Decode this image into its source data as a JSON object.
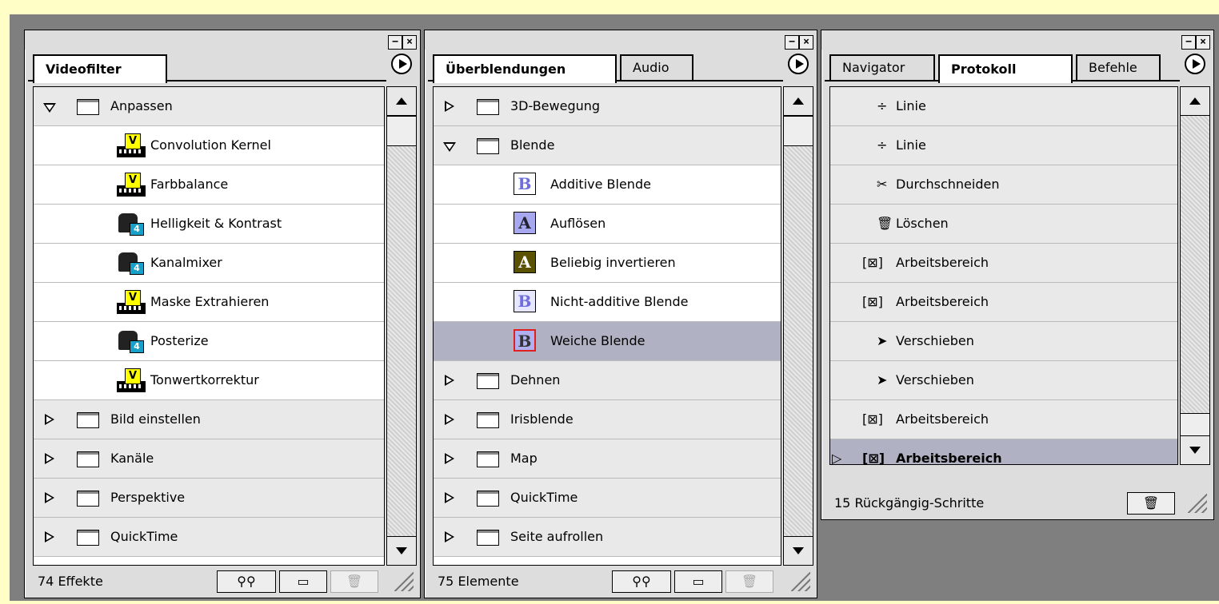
{
  "panels": {
    "left": {
      "tabs": [
        "Videofilter"
      ],
      "rows": [
        {
          "label": "Anpassen"
        },
        {
          "label": "Convolution Kernel"
        },
        {
          "label": "Farbbalance"
        },
        {
          "label": "Helligkeit & Kontrast"
        },
        {
          "label": "Kanalmixer"
        },
        {
          "label": "Maske Extrahieren"
        },
        {
          "label": "Posterize"
        },
        {
          "label": "Tonwertkorrektur"
        },
        {
          "label": "Bild einstellen"
        },
        {
          "label": "Kanäle"
        },
        {
          "label": "Perspektive"
        },
        {
          "label": "QuickTime"
        }
      ],
      "status": "74 Effekte"
    },
    "middle": {
      "tabs": [
        "Überblendungen",
        "Audio"
      ],
      "rows": [
        {
          "label": "3D-Bewegung"
        },
        {
          "label": "Blende"
        },
        {
          "label": "Additive Blende"
        },
        {
          "label": "Auflösen"
        },
        {
          "label": "Beliebig invertieren"
        },
        {
          "label": "Nicht-additive Blende"
        },
        {
          "label": "Weiche Blende"
        },
        {
          "label": "Dehnen"
        },
        {
          "label": "Irisblende"
        },
        {
          "label": "Map"
        },
        {
          "label": "QuickTime"
        },
        {
          "label": "Seite aufrollen"
        }
      ],
      "status": "75 Elemente"
    },
    "right": {
      "tabs": [
        "Navigator",
        "Protokoll",
        "Befehle"
      ],
      "rows": [
        {
          "label": "Linie"
        },
        {
          "label": "Linie"
        },
        {
          "label": "Durchschneiden"
        },
        {
          "label": "Löschen"
        },
        {
          "label": "Arbeitsbereich"
        },
        {
          "label": "Arbeitsbereich"
        },
        {
          "label": "Verschieben"
        },
        {
          "label": "Verschieben"
        },
        {
          "label": "Arbeitsbereich"
        },
        {
          "label": "Arbeitsbereich"
        }
      ],
      "status": "15 Rückgängig-Schritte"
    }
  },
  "window_controls": {
    "collapse": "−",
    "close": "×"
  },
  "icons": {
    "find": "binoculars-icon",
    "new_folder": "folder-icon",
    "delete": "trash-icon"
  },
  "colors": {
    "background": "#7f7f7f",
    "desktop": "#fefec6",
    "selected_row": "#b1b1c4"
  }
}
